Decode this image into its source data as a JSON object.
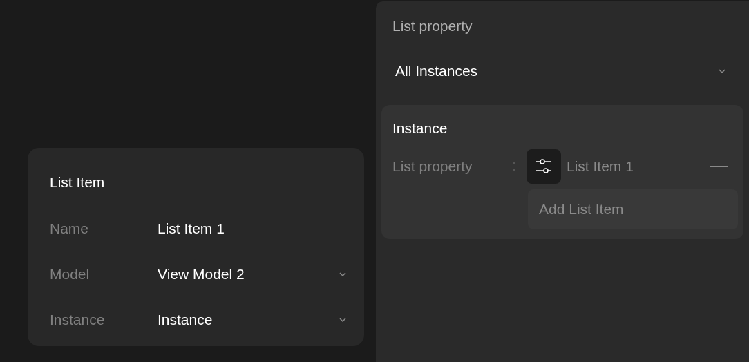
{
  "list_item_card": {
    "title": "List Item",
    "rows": [
      {
        "label": "Name",
        "value": "List Item 1",
        "kind": "text"
      },
      {
        "label": "Model",
        "value": "View Model 2",
        "kind": "dropdown"
      },
      {
        "label": "Instance",
        "value": "Instance",
        "kind": "dropdown"
      }
    ]
  },
  "properties_panel": {
    "section_label": "List property",
    "dropdown": {
      "value": "All Instances"
    },
    "instance": {
      "title": "Instance",
      "property_label": "List property",
      "item": "List Item 1",
      "add_button": "Add List Item"
    }
  }
}
